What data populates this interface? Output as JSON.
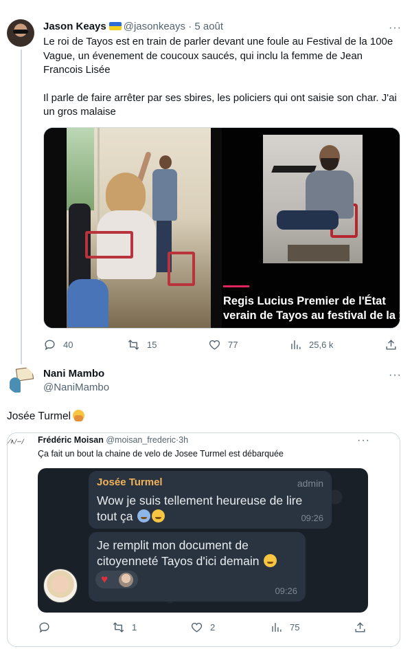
{
  "tweet1": {
    "author_name": "Jason Keays",
    "handle": "@jasonkeays",
    "separator": "·",
    "date": "5 août",
    "more": "···",
    "paragraphs": [
      "Le roi de Tayos est en train de parler devant une foule au Festival de la 100e Vague, un évenement de coucoux saucés, qui inclu la femme de Jean Francois Lisée",
      "Il parle de faire arrêter par ses sbires, les policiers qui ont saisie son char. J'ai un gros malaise"
    ],
    "video_caption_line1": "Regis Lucius Premier de l'État",
    "video_caption_line2": "verain de Tayos au festival de la 1",
    "stats": {
      "replies": "40",
      "retweets": "15",
      "likes": "77",
      "views": "25,6 k"
    }
  },
  "tweet2": {
    "author_name": "Nani Mambo",
    "handle": "@NaniMambo",
    "more": "···",
    "text": "Josée Turmel",
    "quote": {
      "avatar_text": "⁄∧∕−∕",
      "author_name": "Frédéric Moisan",
      "handle": "@moisan_frederic",
      "separator": "·",
      "time": "3h",
      "more": "···",
      "text": "Ça fait un bout la chaine de velo de Josee Turmel est débarquée",
      "chat": {
        "msg1": {
          "sender": "Josée Turmel",
          "role": "admin",
          "text": "Wow je suis tellement heureuse de lire tout ça",
          "time": "09:26"
        },
        "msg2": {
          "text": "Je remplit mon document de citoyenneté Tayos d'ici demain",
          "time": "09:26",
          "reaction": "♥"
        }
      },
      "stats": {
        "retweets": "1",
        "likes": "2",
        "views": "75"
      }
    }
  }
}
